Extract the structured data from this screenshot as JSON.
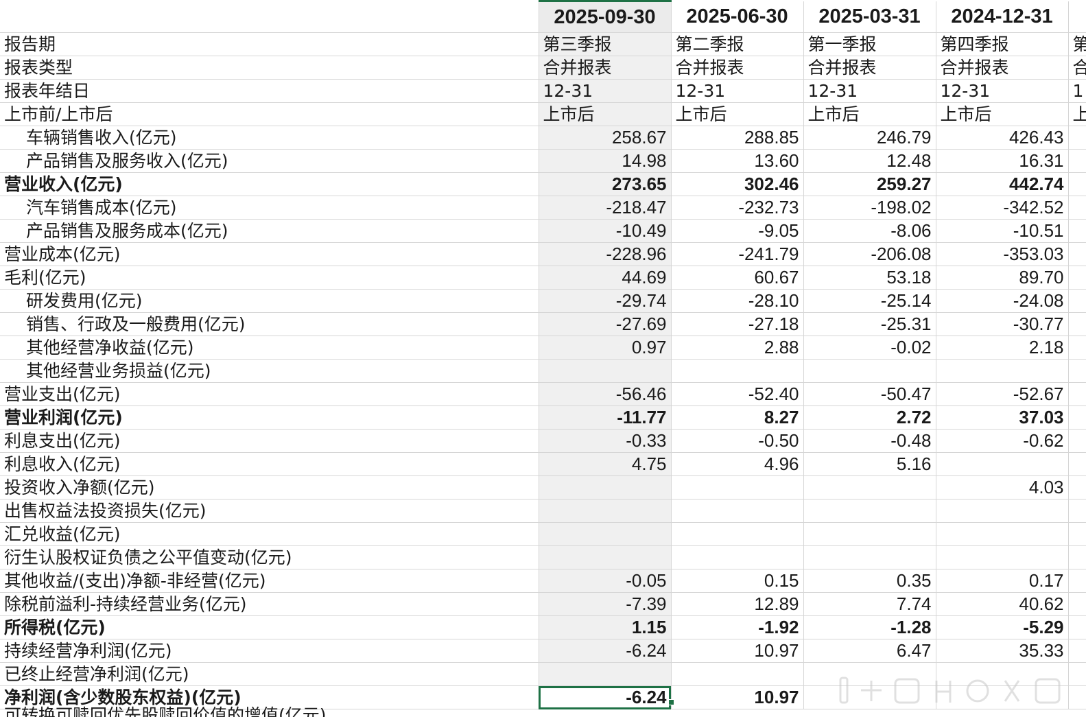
{
  "sheet": {
    "columns": [
      {
        "date": "2025-09-30",
        "report": "第三季报",
        "type": "合并报表",
        "fy_end": "12-31",
        "listing": "上市后"
      },
      {
        "date": "2025-06-30",
        "report": "第二季报",
        "type": "合并报表",
        "fy_end": "12-31",
        "listing": "上市后"
      },
      {
        "date": "2025-03-31",
        "report": "第一季报",
        "type": "合并报表",
        "fy_end": "12-31",
        "listing": "上市后"
      },
      {
        "date": "2024-12-31",
        "report": "第四季报",
        "type": "合并报表",
        "fy_end": "12-31",
        "listing": "上市后"
      }
    ],
    "clipped_column": {
      "report": "第",
      "type": "合",
      "fy_end": "1",
      "listing": "上"
    },
    "meta_labels": [
      "报告期",
      "报表类型",
      "报表年结日",
      "上市前/上市后"
    ],
    "rows": [
      {
        "label": "车辆销售收入(亿元)",
        "indent": true,
        "bold": false,
        "values": [
          "258.67",
          "288.85",
          "246.79",
          "426.43"
        ]
      },
      {
        "label": "产品销售及服务收入(亿元)",
        "indent": true,
        "bold": false,
        "values": [
          "14.98",
          "13.60",
          "12.48",
          "16.31"
        ]
      },
      {
        "label": "营业收入(亿元)",
        "indent": false,
        "bold": true,
        "values": [
          "273.65",
          "302.46",
          "259.27",
          "442.74"
        ]
      },
      {
        "label": "汽车销售成本(亿元)",
        "indent": true,
        "bold": false,
        "values": [
          "-218.47",
          "-232.73",
          "-198.02",
          "-342.52"
        ]
      },
      {
        "label": "产品销售及服务成本(亿元)",
        "indent": true,
        "bold": false,
        "values": [
          "-10.49",
          "-9.05",
          "-8.06",
          "-10.51"
        ]
      },
      {
        "label": "营业成本(亿元)",
        "indent": false,
        "bold": false,
        "values": [
          "-228.96",
          "-241.79",
          "-206.08",
          "-353.03"
        ]
      },
      {
        "label": "毛利(亿元)",
        "indent": false,
        "bold": false,
        "values": [
          "44.69",
          "60.67",
          "53.18",
          "89.70"
        ]
      },
      {
        "label": "研发费用(亿元)",
        "indent": true,
        "bold": false,
        "values": [
          "-29.74",
          "-28.10",
          "-25.14",
          "-24.08"
        ]
      },
      {
        "label": "销售、行政及一般费用(亿元)",
        "indent": true,
        "bold": false,
        "values": [
          "-27.69",
          "-27.18",
          "-25.31",
          "-30.77"
        ]
      },
      {
        "label": "其他经营净收益(亿元)",
        "indent": true,
        "bold": false,
        "values": [
          "0.97",
          "2.88",
          "-0.02",
          "2.18"
        ]
      },
      {
        "label": "其他经营业务损益(亿元)",
        "indent": true,
        "bold": false,
        "values": [
          "",
          "",
          "",
          ""
        ]
      },
      {
        "label": "营业支出(亿元)",
        "indent": false,
        "bold": false,
        "values": [
          "-56.46",
          "-52.40",
          "-50.47",
          "-52.67"
        ]
      },
      {
        "label": "营业利润(亿元)",
        "indent": false,
        "bold": true,
        "values": [
          "-11.77",
          "8.27",
          "2.72",
          "37.03"
        ]
      },
      {
        "label": "利息支出(亿元)",
        "indent": false,
        "bold": false,
        "values": [
          "-0.33",
          "-0.50",
          "-0.48",
          "-0.62"
        ]
      },
      {
        "label": "利息收入(亿元)",
        "indent": false,
        "bold": false,
        "values": [
          "4.75",
          "4.96",
          "5.16",
          ""
        ]
      },
      {
        "label": "投资收入净额(亿元)",
        "indent": false,
        "bold": false,
        "values": [
          "",
          "",
          "",
          "4.03"
        ]
      },
      {
        "label": "出售权益法投资损失(亿元)",
        "indent": false,
        "bold": false,
        "values": [
          "",
          "",
          "",
          ""
        ]
      },
      {
        "label": "汇兑收益(亿元)",
        "indent": false,
        "bold": false,
        "values": [
          "",
          "",
          "",
          ""
        ]
      },
      {
        "label": "衍生认股权证负债之公平值变动(亿元)",
        "indent": false,
        "bold": false,
        "values": [
          "",
          "",
          "",
          ""
        ]
      },
      {
        "label": "其他收益/(支出)净额-非经营(亿元)",
        "indent": false,
        "bold": false,
        "values": [
          "-0.05",
          "0.15",
          "0.35",
          "0.17"
        ]
      },
      {
        "label": "除税前溢利-持续经营业务(亿元)",
        "indent": false,
        "bold": false,
        "values": [
          "-7.39",
          "12.89",
          "7.74",
          "40.62"
        ]
      },
      {
        "label": "所得税(亿元)",
        "indent": false,
        "bold": true,
        "values": [
          "1.15",
          "-1.92",
          "-1.28",
          "-5.29"
        ]
      },
      {
        "label": "持续经营净利润(亿元)",
        "indent": false,
        "bold": false,
        "values": [
          "-6.24",
          "10.97",
          "6.47",
          "35.33"
        ]
      },
      {
        "label": "已终止经营净利润(亿元)",
        "indent": false,
        "bold": false,
        "values": [
          "",
          "",
          "",
          ""
        ]
      },
      {
        "label": "净利润(含少数股东权益)(亿元)",
        "indent": false,
        "bold": true,
        "values": [
          "-6.24",
          "10.97",
          "",
          ""
        ]
      }
    ],
    "partial_row_label": "可转换可赎回优先股赎回价值的增值(亿元)",
    "selected_column_index": 0,
    "active_cell": {
      "row_label": "净利润(含少数股东权益)(亿元)",
      "value": "-6.24"
    },
    "colors": {
      "selection_border": "#1e7145",
      "selected_column_fill": "#f0f0f0",
      "grid": "#d6d6d6"
    }
  }
}
